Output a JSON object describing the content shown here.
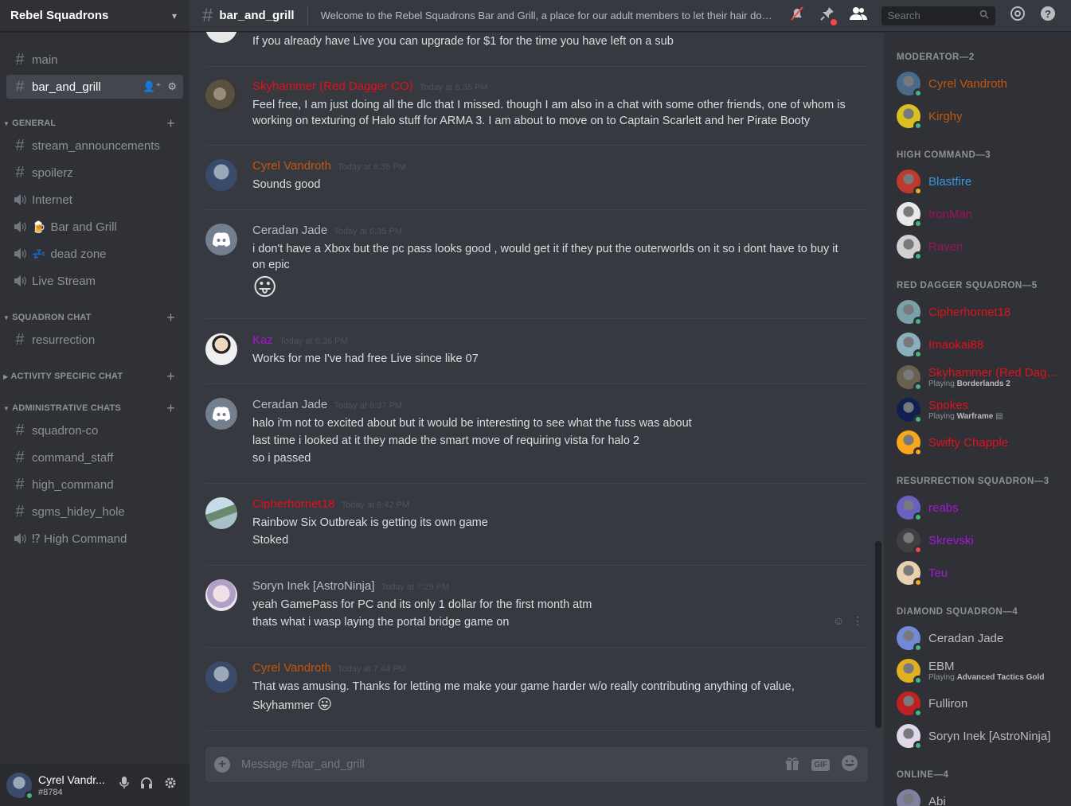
{
  "server": {
    "name": "Rebel Squadrons"
  },
  "channels": {
    "top": [
      {
        "name": "main",
        "type": "text"
      },
      {
        "name": "bar_and_grill",
        "type": "text",
        "active": true
      }
    ],
    "categories": [
      {
        "name": "GENERAL"
      },
      {
        "name": "SQUADRON CHAT"
      },
      {
        "name": "ACTIVITY SPECIFIC CHAT"
      },
      {
        "name": "ADMINISTRATIVE CHATS"
      }
    ],
    "general": [
      {
        "name": "stream_announcements",
        "type": "text"
      },
      {
        "name": "spoilerz",
        "type": "text"
      },
      {
        "name": "Internet",
        "type": "voice"
      },
      {
        "name": "Bar and Grill",
        "type": "voice",
        "emoji": "🍺"
      },
      {
        "name": "dead zone",
        "type": "voice",
        "emoji": "💤"
      },
      {
        "name": "Live Stream",
        "type": "voice"
      }
    ],
    "squadron": [
      {
        "name": "resurrection",
        "type": "text"
      }
    ],
    "admin": [
      {
        "name": "squadron-co",
        "type": "text"
      },
      {
        "name": "command_staff",
        "type": "text"
      },
      {
        "name": "high_command",
        "type": "text"
      },
      {
        "name": "sgms_hidey_hole",
        "type": "text"
      },
      {
        "name": "⁉ High Command",
        "type": "voice"
      }
    ]
  },
  "user_panel": {
    "username": "Cyrel Vandr...",
    "discriminator": "#8784"
  },
  "topbar": {
    "channel": "bar_and_grill",
    "topic": "Welcome to the Rebel Squadrons Bar and Grill, a place for our adult members to let their hair dow...",
    "search_placeholder": "Search"
  },
  "messages": [
    {
      "author": "",
      "time": "",
      "color": "#dcddde",
      "lines": [
        "If you already have Live you can upgrade for $1 for the time you have left on a sub"
      ]
    },
    {
      "author": "Skyhammer (Red Dagger CO)",
      "time": "Today at 6:35 PM",
      "color": "#e0111b",
      "lines": [
        "Feel free, I am just doing all the dlc that I missed. though I am also in a chat with some other friends, one of whom is",
        "working on texturing of Halo stuff for ARMA 3. I am about to move on to Captain Scarlett and her Pirate Booty"
      ]
    },
    {
      "author": "Cyrel Vandroth",
      "time": "Today at 6:35 PM",
      "color": "#c2570e",
      "lines": [
        "Sounds good"
      ]
    },
    {
      "author": "Ceradan Jade",
      "time": "Today at 6:35 PM",
      "color": "#b9bbbe",
      "lines": [
        "i don't have a Xbox but the pc pass looks good , would get it if they put the outerworlds on it so i dont have to buy it",
        "on epic"
      ],
      "emoji": "😛"
    },
    {
      "author": "Kaz",
      "time": "Today at 6:36 PM",
      "color": "#a616d8",
      "lines": [
        "Works for me I've had free Live since like 07"
      ]
    },
    {
      "author": "Ceradan Jade",
      "time": "Today at 6:37 PM",
      "color": "#b9bbbe",
      "lines": [
        "halo i'm not to excited about but it would be interesting to see what the fuss was about",
        "last time i looked at it they made the smart move  of requiring vista for halo 2",
        "so i passed"
      ]
    },
    {
      "author": "Cipherhornet18",
      "time": "Today at 6:42 PM",
      "color": "#e0111b",
      "lines": [
        "Rainbow Six Outbreak is getting its own game",
        "Stoked"
      ]
    },
    {
      "author": "Soryn Inek [AstroNinja]",
      "time": "Today at 7:29 PM",
      "color": "#b9bbbe",
      "lines": [
        "yeah GamePass for PC and its only 1 dollar for the first month atm",
        "thats what i wasp laying the portal bridge game on"
      ]
    },
    {
      "author": "Cyrel Vandroth",
      "time": "Today at 7:44 PM",
      "color": "#c2570e",
      "lines": [
        "That was amusing. Thanks for letting me make your game harder w/o really contributing anything of value,",
        "Skyhammer"
      ],
      "inline_emoji": "😛"
    }
  ],
  "composer": {
    "placeholder": "Message #bar_and_grill",
    "gif_label": "GIF"
  },
  "members": {
    "groups": [
      {
        "title": "MODERATOR—2",
        "members": [
          {
            "name": "Cyrel Vandroth",
            "color": "#c2570e",
            "status": "#43b581",
            "avatar": "#4a6a8a"
          },
          {
            "name": "Kirghy",
            "color": "#c2570e",
            "status": "#43b581",
            "avatar": "#d8c020"
          }
        ]
      },
      {
        "title": "HIGH COMMAND—3",
        "members": [
          {
            "name": "Blastfire",
            "color": "#3498db",
            "status": "#faa61a",
            "avatar": "#c0392b"
          },
          {
            "name": "IronMan",
            "color": "#a0125a",
            "status": "#43b581",
            "avatar": "#e8e8e8"
          },
          {
            "name": "Raven",
            "color": "#a0125a",
            "status": "#43b581",
            "avatar": "#d0d0d0"
          }
        ]
      },
      {
        "title": "RED DAGGER SQUADRON—5",
        "members": [
          {
            "name": "Cipherhornet18",
            "color": "#e0111b",
            "status": "#43b581",
            "avatar": "#7aa0a8"
          },
          {
            "name": "Imaokai88",
            "color": "#e0111b",
            "status": "#43b581",
            "avatar": "#8ab0c0"
          },
          {
            "name": "Skyhammer (Red Dagg...",
            "color": "#e0111b",
            "status": "#43b581",
            "avatar": "#6a6050",
            "activity_prefix": "Playing ",
            "activity": "Borderlands 2"
          },
          {
            "name": "Spokes",
            "color": "#e0111b",
            "status": "#43b581",
            "avatar": "#102050",
            "activity_prefix": "Playing ",
            "activity": "Warframe"
          },
          {
            "name": "Swifty Chapple",
            "color": "#e0111b",
            "status": "#faa61a",
            "avatar": "#faa61a"
          }
        ]
      },
      {
        "title": "RESURRECTION SQUADRON—3",
        "members": [
          {
            "name": "reabs",
            "color": "#a616d8",
            "status": "#43b581",
            "avatar": "#6a60c0"
          },
          {
            "name": "Skrevski",
            "color": "#a616d8",
            "status": "#f04747",
            "avatar": "#404040"
          },
          {
            "name": "Teu",
            "color": "#a616d8",
            "status": "#faa61a",
            "avatar": "#e8d0b0"
          }
        ]
      },
      {
        "title": "DIAMOND SQUADRON—4",
        "members": [
          {
            "name": "Ceradan Jade",
            "color": "#b9bbbe",
            "status": "#43b581",
            "avatar": "#7289da"
          },
          {
            "name": "EBM",
            "color": "#b9bbbe",
            "status": "#43b581",
            "avatar": "#e0b020",
            "activity_prefix": "Playing ",
            "activity": "Advanced Tactics Gold"
          },
          {
            "name": "Fulliron",
            "color": "#b9bbbe",
            "status": "#43b581",
            "avatar": "#c02020"
          },
          {
            "name": "Soryn Inek [AstroNinja]",
            "color": "#b9bbbe",
            "status": "#43b581",
            "avatar": "#e0d8e8"
          }
        ]
      },
      {
        "title": "ONLINE—4",
        "members": [
          {
            "name": "Abi",
            "color": "#b9bbbe",
            "status": "#43b581",
            "avatar": "#8080a0"
          }
        ]
      }
    ]
  },
  "colors": {
    "bg": "#36393f",
    "sidebar": "#2f3136",
    "accent": "#7289da",
    "online": "#43b581",
    "idle": "#faa61a",
    "dnd": "#f04747"
  }
}
